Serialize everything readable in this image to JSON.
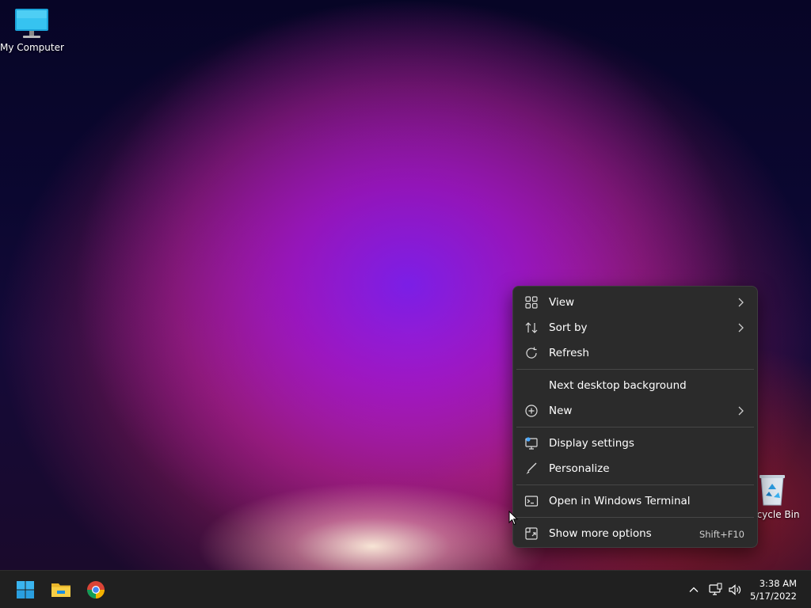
{
  "desktop": {
    "icons": [
      {
        "label": "My Computer",
        "icon": "monitor-icon"
      },
      {
        "label": "Recycle Bin",
        "icon": "recycle-bin-icon"
      }
    ]
  },
  "context_menu": {
    "items": [
      {
        "label": "View",
        "icon": "grid-icon",
        "submenu": true
      },
      {
        "label": "Sort by",
        "icon": "sort-icon",
        "submenu": true
      },
      {
        "label": "Refresh",
        "icon": "refresh-icon"
      },
      {
        "label": "Next desktop background"
      },
      {
        "label": "New",
        "icon": "plus-circle-icon",
        "submenu": true
      },
      {
        "label": "Display settings",
        "icon": "display-settings-icon"
      },
      {
        "label": "Personalize",
        "icon": "brush-icon"
      },
      {
        "label": "Open in Windows Terminal",
        "icon": "terminal-icon"
      },
      {
        "label": "Show more options",
        "icon": "more-options-icon",
        "shortcut": "Shift+F10"
      }
    ]
  },
  "taskbar": {
    "apps": [
      {
        "name": "Start",
        "icon": "windows-logo-icon"
      },
      {
        "name": "File Explorer",
        "icon": "folder-icon"
      },
      {
        "name": "Google Chrome",
        "icon": "chrome-icon"
      }
    ],
    "tray": {
      "icons": [
        "chevron-up-icon",
        "network-icon",
        "volume-icon"
      ],
      "time": "3:38 AM",
      "date": "5/17/2022"
    }
  },
  "colors": {
    "menu_bg": "#2b2b2b",
    "taskbar_bg": "#202020",
    "accent": "#0078d4"
  }
}
